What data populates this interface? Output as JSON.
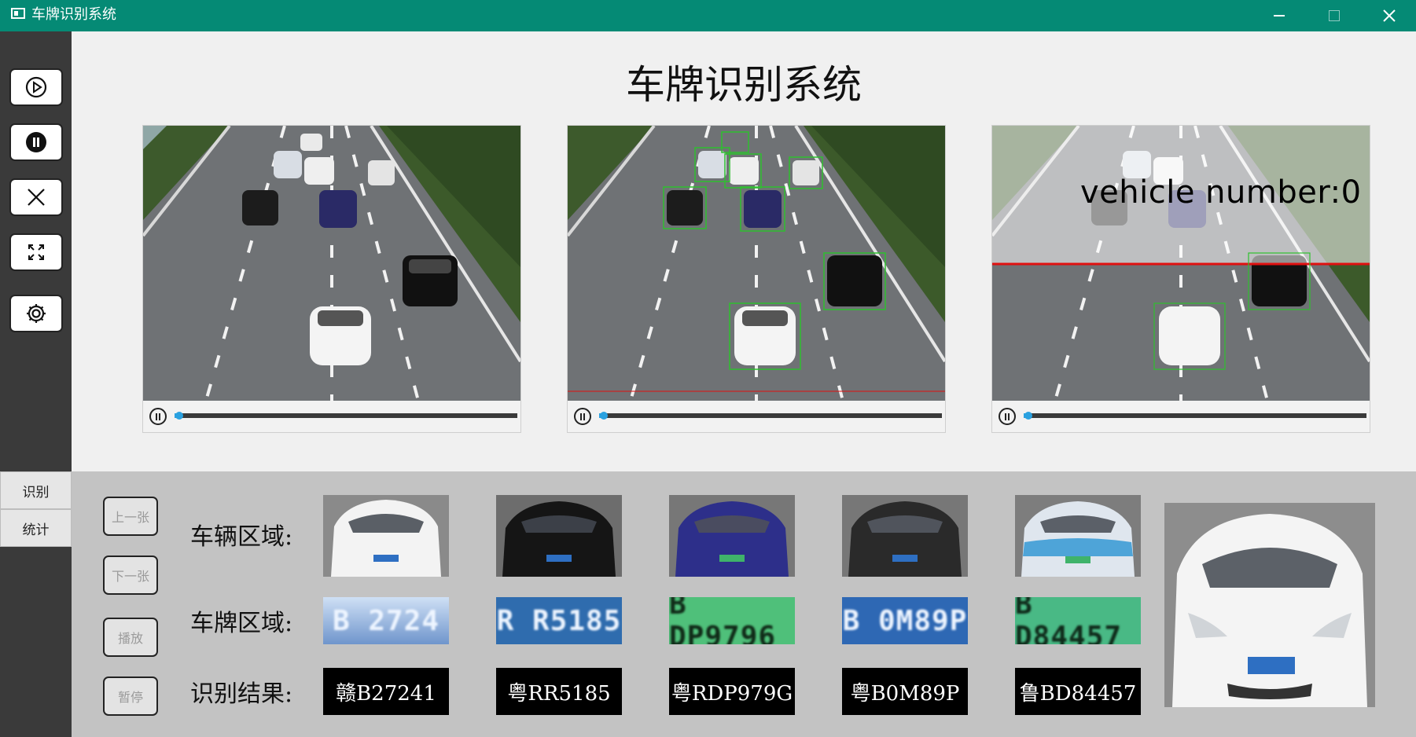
{
  "window": {
    "title": "车牌识别系统"
  },
  "sidebar": {
    "buttons": [
      {
        "icon": "play-icon"
      },
      {
        "icon": "pause-icon"
      },
      {
        "icon": "close-icon"
      },
      {
        "icon": "fullscreen-icon"
      },
      {
        "icon": "gear-icon"
      }
    ],
    "tabs": [
      "识别",
      "统计"
    ]
  },
  "main": {
    "title": "车牌识别系统",
    "videos": [
      {
        "overlay": "",
        "progress": 0.01
      },
      {
        "overlay": "",
        "progress": 0.01
      },
      {
        "overlay": "vehicle number:0",
        "progress": 0.01
      }
    ]
  },
  "bottom": {
    "nav_buttons": [
      "上一张",
      "下一张",
      "播放",
      "暂停"
    ],
    "labels": {
      "vehicle_region": "车辆区域:",
      "plate_region": "车牌区域:",
      "result": "识别结果:"
    },
    "plates": [
      "B 2724",
      "R R5185",
      "B DP9796",
      "B 0M89P",
      "B D84457"
    ],
    "results": [
      "赣B27241",
      "粤RR5185",
      "粤RDP979G",
      "粤B0M89P",
      "鲁BD84457"
    ]
  },
  "colors": {
    "titlebar": "#058a75",
    "sidebar": "#3a3a3a",
    "accent": "#2aa1e0",
    "detection_box": "#2ec02e",
    "count_line": "#e01010"
  }
}
